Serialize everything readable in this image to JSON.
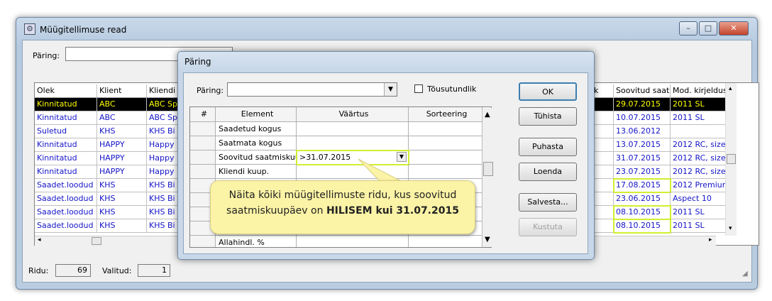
{
  "window": {
    "title": "Müügitellimuse read",
    "min": "–",
    "max": "□",
    "close": "✕"
  },
  "query_bar": {
    "label": "Päring:",
    "value": ""
  },
  "grid": {
    "columns": [
      "Olek",
      "Klient",
      "Kliendi r",
      "ühik",
      "Soovitud saatm",
      "Mod. kirjeldus"
    ],
    "rows": [
      {
        "olek": "Kinnitatud",
        "klient": "ABC",
        "nimi": "ABC Sp",
        "kp": "29.07.2015",
        "mod": "2011 SL",
        "selected": true,
        "highlight": false
      },
      {
        "olek": "Kinnitatud",
        "klient": "ABC",
        "nimi": "ABC Sp",
        "kp": "10.07.2015",
        "mod": "2011 SL",
        "selected": false,
        "highlight": false
      },
      {
        "olek": "Suletud",
        "klient": "KHS",
        "nimi": "KHS Bi",
        "kp": "13.06.2012",
        "mod": "",
        "selected": false,
        "highlight": false
      },
      {
        "olek": "Kinnitatud",
        "klient": "HAPPY",
        "nimi": "Happy",
        "kp": "13.07.2015",
        "mod": "2012 RC, size",
        "selected": false,
        "highlight": false
      },
      {
        "olek": "Kinnitatud",
        "klient": "HAPPY",
        "nimi": "Happy",
        "kp": "31.07.2015",
        "mod": "2012 RC, size",
        "selected": false,
        "highlight": false
      },
      {
        "olek": "Kinnitatud",
        "klient": "HAPPY",
        "nimi": "Happy",
        "kp": "23.07.2015",
        "mod": "2012 RC, size",
        "selected": false,
        "highlight": false
      },
      {
        "olek": "Saadet.loodud",
        "klient": "KHS",
        "nimi": "KHS Bi",
        "kp": "17.08.2015",
        "mod": "2012 Premium",
        "selected": false,
        "highlight": true
      },
      {
        "olek": "Saadet.loodud",
        "klient": "KHS",
        "nimi": "KHS Bi",
        "kp": "23.06.2015",
        "mod": "Aspect 10",
        "selected": false,
        "highlight": false
      },
      {
        "olek": "Saadet.loodud",
        "klient": "KHS",
        "nimi": "KHS Bi",
        "kp": "08.10.2015",
        "mod": "2011 SL",
        "selected": false,
        "highlight": true
      },
      {
        "olek": "Saadet.loodud",
        "klient": "KHS",
        "nimi": "KHS Bi",
        "kp": "08.10.2015",
        "mod": "2011 SL",
        "selected": false,
        "highlight": true
      }
    ]
  },
  "status": {
    "ridu_label": "Ridu:",
    "ridu_value": "69",
    "valitud_label": "Valitud:",
    "valitud_value": "1"
  },
  "dialog": {
    "title": "Päring",
    "query_label": "Päring:",
    "query_value": "",
    "checkbox_label": "Tõusutundlik",
    "columns": [
      "#",
      "Element",
      "Väärtus",
      "Sorteering"
    ],
    "rows": [
      {
        "element": "Saadetud kogus",
        "value": "",
        "sort": ""
      },
      {
        "element": "Saatmata kogus",
        "value": "",
        "sort": ""
      },
      {
        "element": "Soovitud saatmiskuu",
        "value": ">31.07.2015",
        "sort": ""
      },
      {
        "element": "Kliendi kuup.",
        "value": "",
        "sort": ""
      },
      {
        "element": "",
        "value": "",
        "sort": ""
      },
      {
        "element": "",
        "value": "",
        "sort": ""
      },
      {
        "element": "",
        "value": "",
        "sort": ""
      },
      {
        "element": "",
        "value": "",
        "sort": ""
      },
      {
        "element": "Allahindl. %",
        "value": "",
        "sort": ""
      }
    ],
    "buttons": {
      "ok": "OK",
      "cancel": "Tühista",
      "clear": "Puhasta",
      "read": "Loenda",
      "save": "Salvesta...",
      "delete": "Kustuta"
    }
  },
  "callout": {
    "line1": "Näita kõiki müügitellimuste ridu, kus soovitud",
    "line2_prefix": "saatmiskuupäev on",
    "line2_bold": "HILISEM kui 31.07.2015"
  },
  "colors": {
    "highlight": "#d2ee32",
    "link_text": "#1414c8",
    "callout_bg": "#fbf3a6"
  }
}
